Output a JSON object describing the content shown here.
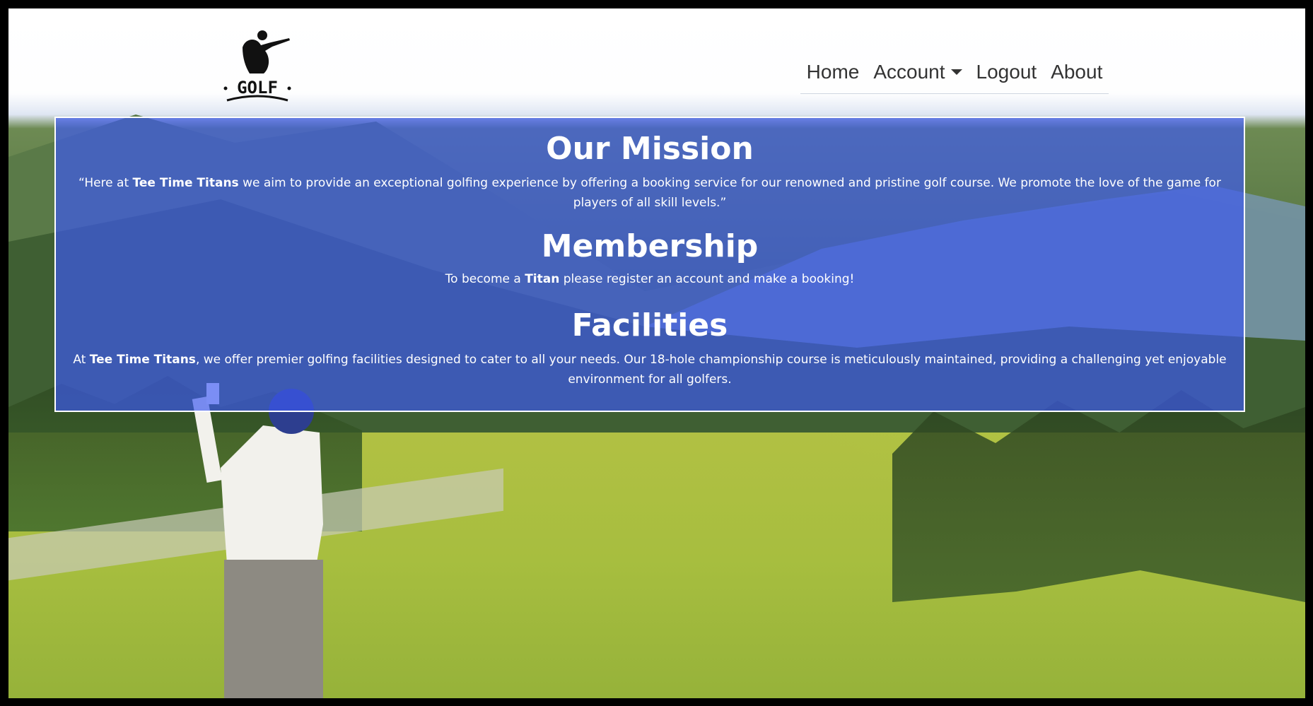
{
  "logo": {
    "text": "GOLF",
    "icon": "golfer-icon"
  },
  "nav": {
    "home": "Home",
    "account": "Account",
    "logout": "Logout",
    "about": "About"
  },
  "mission": {
    "heading": "Our Mission",
    "quote_open": "“Here at ",
    "brand": "Tee Time Titans",
    "text": " we aim to provide an exceptional golfing experience by offering a booking service for our renowned and pristine golf course. We promote the love of the game for players of all skill levels.”"
  },
  "membership": {
    "heading": "Membership",
    "prefix": "To become a ",
    "brand": "Titan",
    "suffix": " please register an account and make a booking!"
  },
  "facilities": {
    "heading": "Facilities",
    "prefix": "At ",
    "brand": "Tee Time Titans",
    "text": ", we offer premier golfing facilities designed to cater to all your needs. Our 18-hole championship course is meticulously maintained, providing a challenging yet enjoyable environment for all golfers."
  },
  "colors": {
    "panel": "#3c58f0",
    "text": "#ffffff",
    "nav_text": "#333333"
  }
}
